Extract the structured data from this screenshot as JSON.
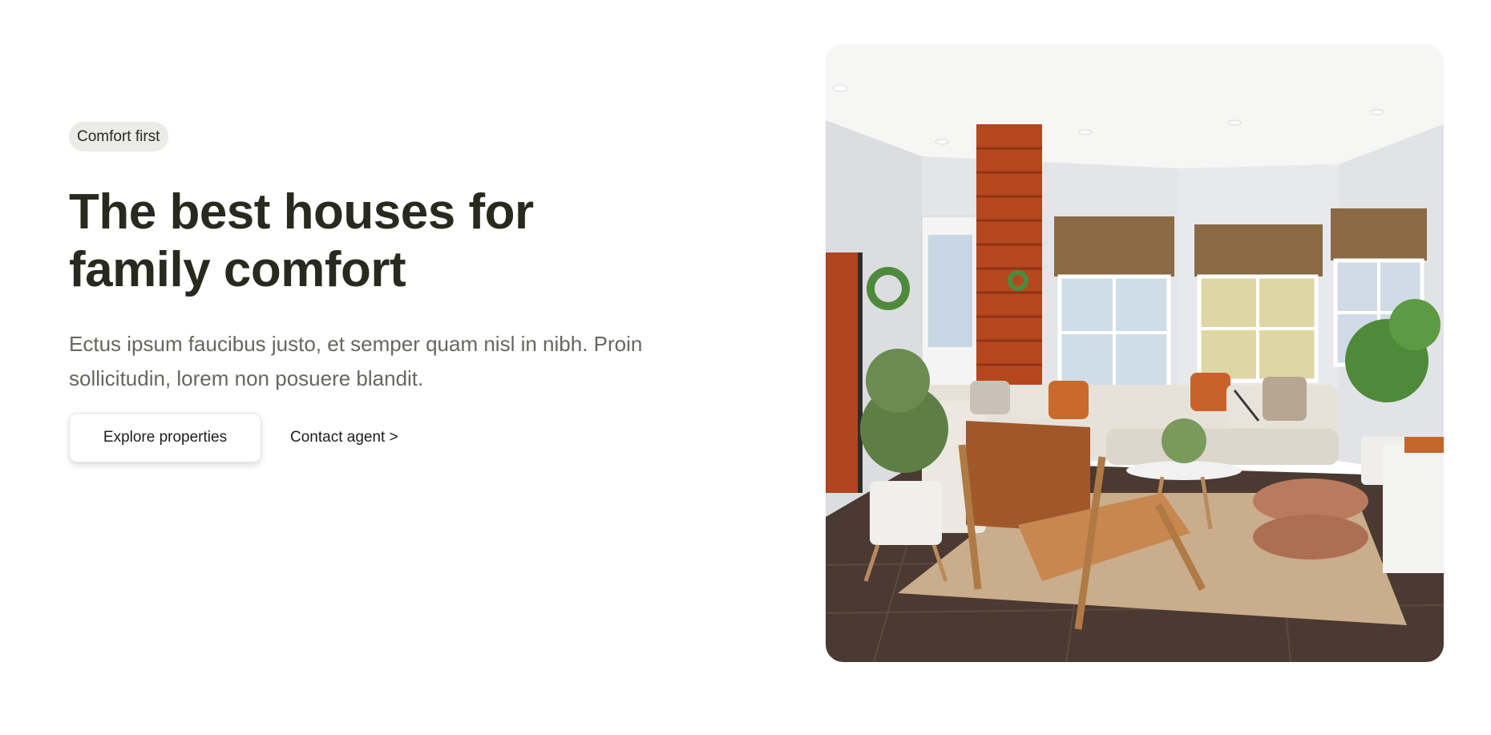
{
  "hero": {
    "badge": "Comfort first",
    "title": "The best houses for family comfort",
    "description": "Ectus ipsum faucibus justo, et semper quam nisl in nibh. Proin sollicitudin, lorem non posuere blandit.",
    "primary_cta": "Explore properties",
    "secondary_cta": "Contact agent >"
  },
  "colors": {
    "title": "#292a1f",
    "badge_bg": "#ebebe7",
    "body_text": "#66675f",
    "accent_rust": "#b5471f"
  }
}
